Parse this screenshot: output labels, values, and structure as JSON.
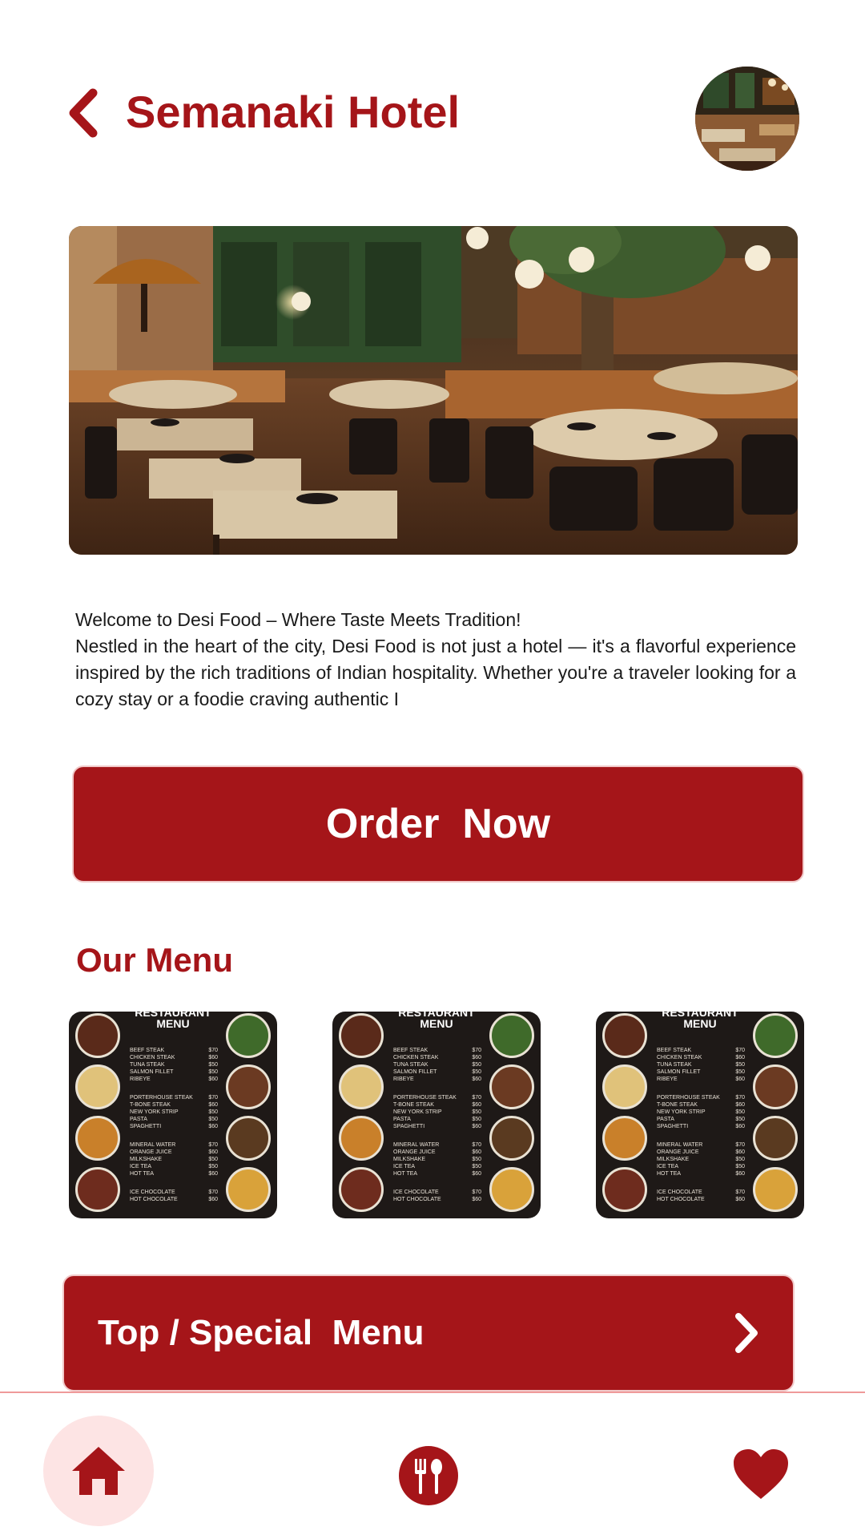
{
  "header": {
    "title": "Semanaki Hotel",
    "back_icon": "chevron-left-icon",
    "avatar": "restaurant-avatar"
  },
  "hero": {
    "image": "restaurant-interior-photo"
  },
  "description": "Welcome to Desi Food – Where Taste Meets Tradition!\n Nestled in the heart of the city, Desi Food is not just a hotel — it's a flavorful experience inspired by the rich traditions of Indian hospitality. Whether you're a traveler looking for a cozy stay or a foodie craving authentic I",
  "actions": {
    "order_label": "Order  Now",
    "special_label": "Top / Special  Menu",
    "special_icon": "chevron-right-icon"
  },
  "menu": {
    "title": "Our Menu",
    "card_heading": [
      "RESTAURANT",
      "MENU"
    ],
    "groups": [
      [
        [
          "BEEF STEAK",
          "$70"
        ],
        [
          "CHICKEN STEAK",
          "$60"
        ],
        [
          "TUNA STEAK",
          "$50"
        ],
        [
          "SALMON FILLET",
          "$50"
        ],
        [
          "RIBEYE",
          "$60"
        ]
      ],
      [
        [
          "PORTERHOUSE STEAK",
          "$70"
        ],
        [
          "T-BONE STEAK",
          "$60"
        ],
        [
          "NEW YORK STRIP",
          "$50"
        ],
        [
          "PASTA",
          "$50"
        ],
        [
          "SPAGHETTI",
          "$60"
        ]
      ],
      [
        [
          "MINERAL WATER",
          "$70"
        ],
        [
          "ORANGE JUICE",
          "$60"
        ],
        [
          "MILKSHAKE",
          "$50"
        ],
        [
          "ICE TEA",
          "$50"
        ],
        [
          "HOT TEA",
          "$60"
        ]
      ],
      [
        [
          "ICE CHOCOLATE",
          "$70"
        ],
        [
          "HOT CHOCOLATE",
          "$60"
        ]
      ]
    ]
  },
  "nav": {
    "home_icon": "home-icon",
    "menu_icon": "fork-spoon-icon",
    "favorites_icon": "heart-icon"
  },
  "colors": {
    "brand": "#a51519",
    "brand_light": "#fde4e4",
    "divider": "#ef9a9a",
    "menu_card_bg": "#1e1917"
  }
}
